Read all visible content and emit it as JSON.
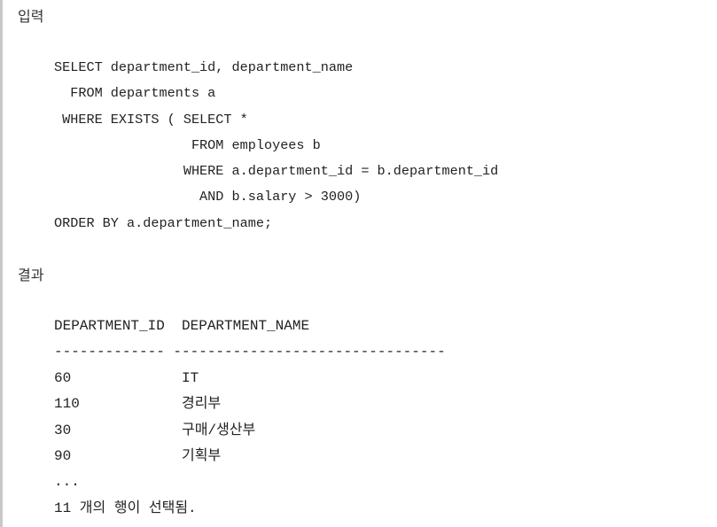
{
  "input_heading": "입력",
  "sql_code": "SELECT department_id, department_name\n  FROM departments a\n WHERE EXISTS ( SELECT *\n                 FROM employees b\n                WHERE a.department_id = b.department_id\n                  AND b.salary > 3000)\nORDER BY a.department_name;",
  "result_heading": "결과",
  "result_output": "DEPARTMENT_ID  DEPARTMENT_NAME\n------------- --------------------------------\n60             IT\n110            경리부\n30             구매/생산부\n90             기획부\n...\n11 개의 행이 선택됨."
}
